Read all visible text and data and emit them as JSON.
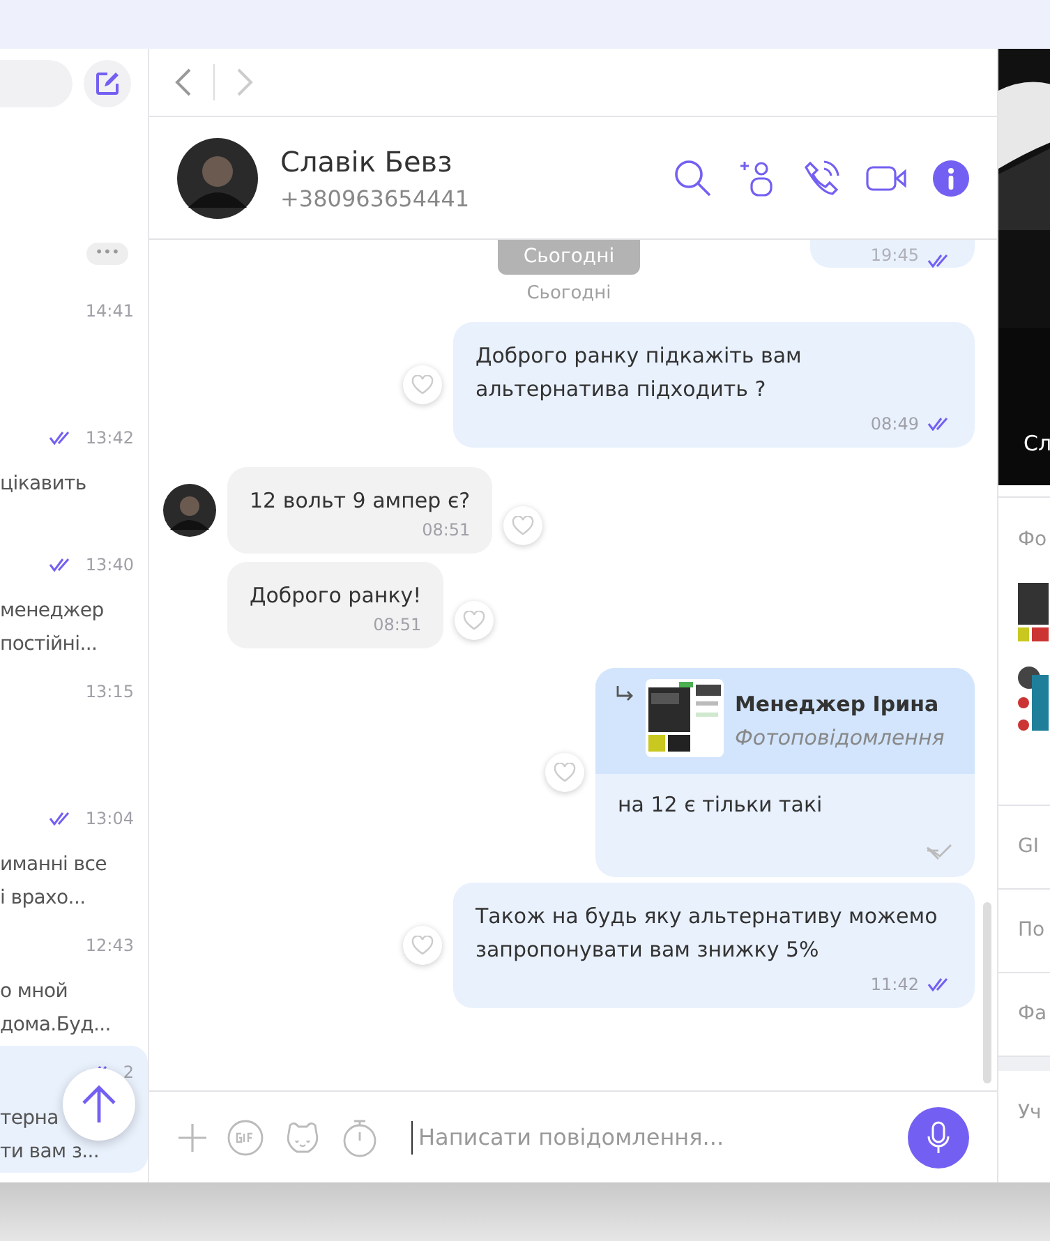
{
  "sidebar": {
    "more": "•••",
    "items": [
      {
        "time": "14:41",
        "read": false,
        "selected": false
      },
      {
        "time": "13:42",
        "read": true,
        "lines": [
          "цікавить"
        ],
        "selected": false
      },
      {
        "time": "13:40",
        "read": true,
        "lines": [
          "менеджер",
          "постійні..."
        ],
        "selected": false
      },
      {
        "time": "13:15",
        "read": false,
        "selected": false
      },
      {
        "time": "13:04",
        "read": true,
        "lines": [
          "иманні все",
          "і врахо..."
        ],
        "selected": false
      },
      {
        "time": "12:43",
        "read": false,
        "lines": [
          "о мной",
          "дома.Буд..."
        ],
        "selected": false
      },
      {
        "time": "2",
        "read": true,
        "lines": [
          "терна",
          "ти вам з..."
        ],
        "selected": true
      }
    ]
  },
  "contact": {
    "name": "Славік Бевз",
    "phone": "+380963654441"
  },
  "chat": {
    "top_time": "19:45",
    "date_pill": "Сьогодні",
    "date_label": "Сьогодні",
    "messages": [
      {
        "kind": "out",
        "text": "Доброго ранку підкажіть вам альтернатива підходить ?",
        "time": "08:49",
        "read": true
      },
      {
        "kind": "in",
        "avatar": true,
        "text": "12 вольт 9 ампер є?",
        "time": "08:51"
      },
      {
        "kind": "in",
        "avatar": false,
        "text": "Доброго ранку!",
        "time": "08:51"
      },
      {
        "kind": "reply",
        "quote_author": "Менеджер Ірина",
        "quote_text": "Фотоповідомлення",
        "text": "на 12 є тільки такі",
        "forwarded": true
      },
      {
        "kind": "out",
        "text": "Також на будь яку альтернативу можемо запропонувати вам знижку 5%",
        "time": "11:42",
        "read": true
      }
    ]
  },
  "composer": {
    "placeholder": "Написати повідомлення..."
  },
  "info_panel": {
    "photo_caption": "Сл",
    "rows": [
      {
        "kind": "media",
        "label": "Фо"
      },
      {
        "kind": "row",
        "label": "GI"
      },
      {
        "kind": "row",
        "label": "По"
      },
      {
        "kind": "row",
        "label": "Фа"
      },
      {
        "kind": "section",
        "label": "Уч"
      }
    ]
  }
}
